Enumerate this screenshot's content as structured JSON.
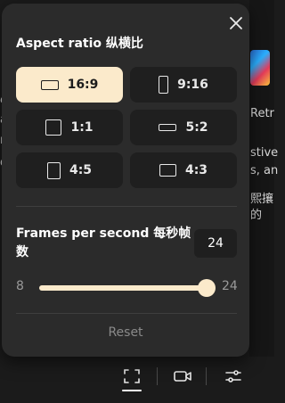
{
  "background": {
    "right_texts": [
      "Retr",
      "stive",
      "s, an",
      "熙攘",
      "的"
    ],
    "left_texts": [
      "e",
      "a",
      "r",
      "d"
    ]
  },
  "panel": {
    "title": "Aspect ratio 纵横比",
    "options": [
      {
        "label": "16:9",
        "selected": true
      },
      {
        "label": "9:16",
        "selected": false
      },
      {
        "label": "1:1",
        "selected": false
      },
      {
        "label": "5:2",
        "selected": false
      },
      {
        "label": "4:5",
        "selected": false
      },
      {
        "label": "4:3",
        "selected": false
      }
    ],
    "fps_label": "Frames per second 每秒帧数",
    "fps_value": "24",
    "slider": {
      "min": "8",
      "max": "24",
      "value": 24
    },
    "reset_label": "Reset"
  },
  "bottom_bar": {
    "icons": [
      "crop-icon",
      "video-camera-icon",
      "sliders-icon"
    ]
  },
  "colors": {
    "accent": "#fbeacb",
    "panel_bg": "#2b2b2b",
    "button_bg": "#1f1f1f"
  }
}
